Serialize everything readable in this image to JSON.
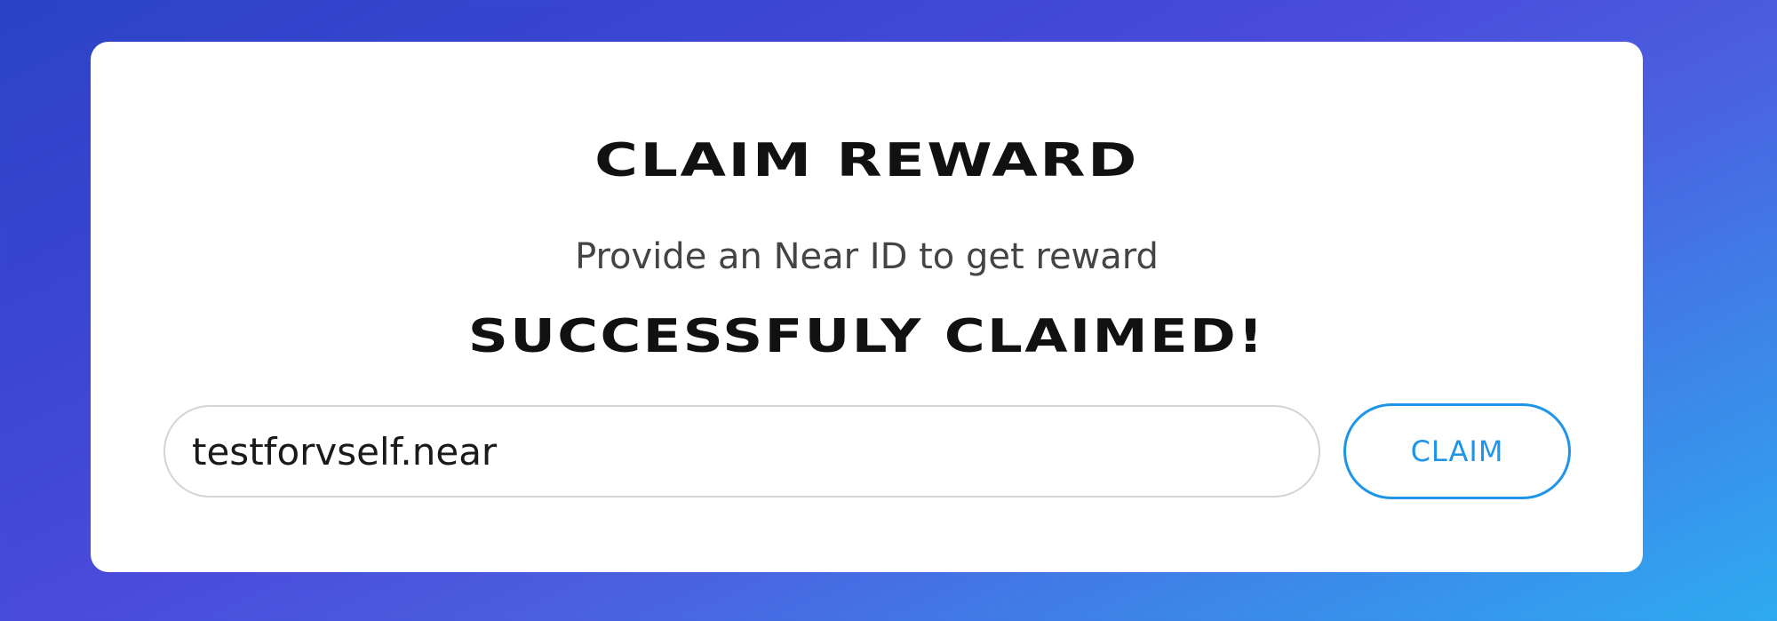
{
  "card": {
    "title": "CLAIM REWARD",
    "subtitle": "Provide an Near ID to get reward",
    "status": "SUCCESSFULY CLAIMED!",
    "near_id_input": {
      "value": "testforvself.near"
    },
    "claim_label": "CLAIM"
  },
  "colors": {
    "accent": "#1e95e8",
    "background_start": "#2b43c6",
    "background_end": "#2eabf0"
  }
}
